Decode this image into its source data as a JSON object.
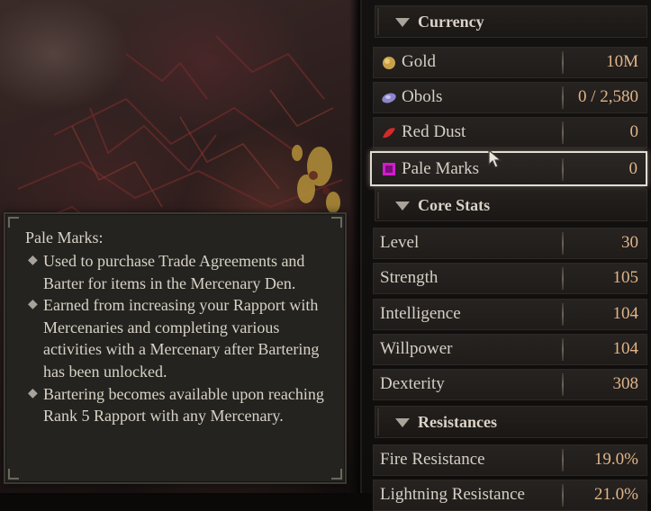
{
  "currency": {
    "header": "Currency",
    "rows": [
      {
        "label": "Gold",
        "value": "10M",
        "icon": "gold-coin-icon"
      },
      {
        "label": "Obols",
        "value": "0 / 2,580",
        "icon": "obol-icon"
      },
      {
        "label": "Red Dust",
        "value": "0",
        "icon": "red-dust-icon"
      },
      {
        "label": "Pale Marks",
        "value": "0",
        "icon": "pale-mark-icon"
      }
    ]
  },
  "core_stats": {
    "header": "Core Stats",
    "rows": [
      {
        "label": "Level",
        "value": "30"
      },
      {
        "label": "Strength",
        "value": "105"
      },
      {
        "label": "Intelligence",
        "value": "104"
      },
      {
        "label": "Willpower",
        "value": "104"
      },
      {
        "label": "Dexterity",
        "value": "308"
      }
    ]
  },
  "resistances": {
    "header": "Resistances",
    "rows": [
      {
        "label": "Fire Resistance",
        "value": "19.0%"
      },
      {
        "label": "Lightning Resistance",
        "value": "21.0%"
      }
    ]
  },
  "tooltip": {
    "title": "Pale Marks:",
    "bullets": [
      "Used to purchase Trade Agreements and Barter for items in the Mercenary Den.",
      "Earned from increasing your Rapport with Mercenaries and completing various activities with a Mercenary after Bartering has been unlocked.",
      "Bartering becomes available upon reaching Rank 5 Rapport with any Mercenary."
    ]
  },
  "colors": {
    "value_text": "#e0b488",
    "pale_mark_icon": "#d21ccc",
    "red_dust_icon": "#d42a2a",
    "gold_icon": "#c9a04a",
    "obol_icon": "#8d86c9"
  }
}
